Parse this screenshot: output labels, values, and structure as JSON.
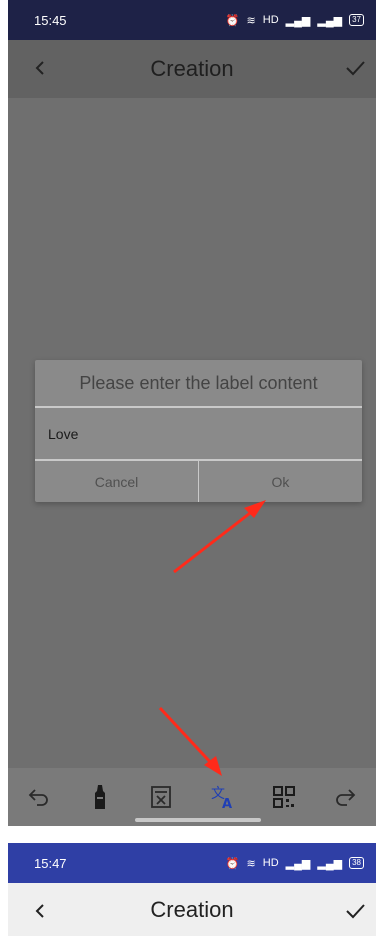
{
  "screens": [
    {
      "status": {
        "time": "15:45",
        "battery": "37"
      },
      "appbar": {
        "title": "Creation"
      },
      "dialog": {
        "title": "Please enter the label content",
        "input_value": "Love",
        "cancel_label": "Cancel",
        "ok_label": "Ok"
      },
      "toolbar": {
        "items": [
          "undo-icon",
          "marker-icon",
          "calculator-icon",
          "translate-icon",
          "qr-code-icon",
          "redo-icon"
        ],
        "active_color": "#1f3fb5"
      }
    },
    {
      "status": {
        "time": "15:47",
        "battery": "38"
      },
      "appbar": {
        "title": "Creation"
      }
    }
  ],
  "colors": {
    "annotation_arrow": "#ff2a1a",
    "status_bar_dim": "#1e2247",
    "status_bar": "#2f3fa5"
  }
}
